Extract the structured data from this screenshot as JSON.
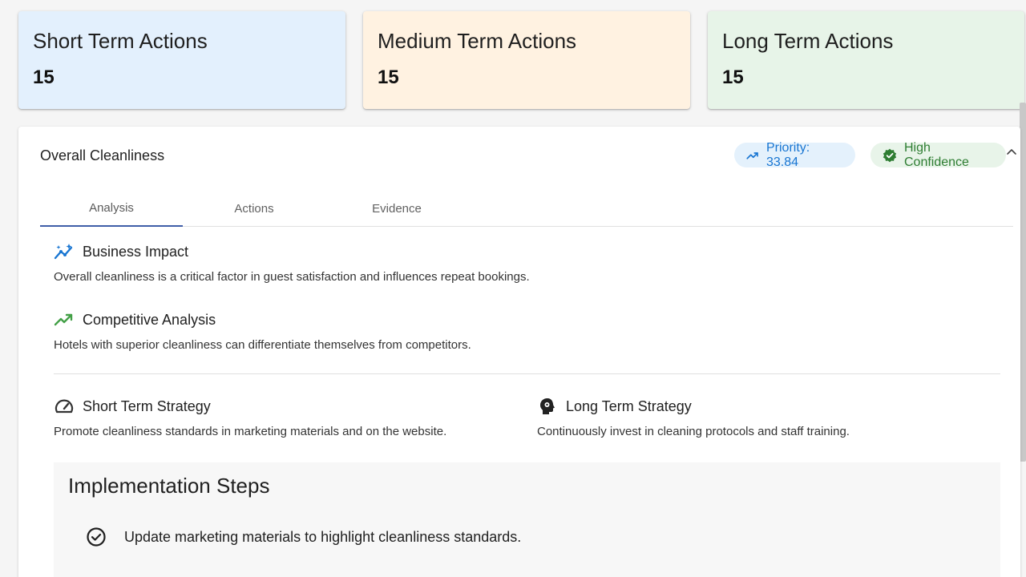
{
  "summary_cards": [
    {
      "title": "Short Term Actions",
      "value": "15",
      "color": "#e3f0fd"
    },
    {
      "title": "Medium Term Actions",
      "value": "15",
      "color": "#fff2e1"
    },
    {
      "title": "Long Term Actions",
      "value": "15",
      "color": "#e7f4e8"
    }
  ],
  "panel": {
    "title": "Overall Cleanliness",
    "priority_chip": {
      "label": "Priority: 33.84",
      "icon": "trending-up-icon",
      "color": "#1976d2"
    },
    "confidence_chip": {
      "label": "High Confidence",
      "icon": "verified-check-icon",
      "color": "#2e7d32"
    },
    "collapse_icon": "chevron-up-icon",
    "tabs": [
      {
        "label": "Analysis",
        "active": true
      },
      {
        "label": "Actions",
        "active": false
      },
      {
        "label": "Evidence",
        "active": false
      }
    ],
    "business_impact": {
      "heading": "Business Impact",
      "icon": "insights-icon",
      "text": "Overall cleanliness is a critical factor in guest satisfaction and influences repeat bookings."
    },
    "competitive_analysis": {
      "heading": "Competitive Analysis",
      "icon": "trending-up-icon",
      "text": "Hotels with superior cleanliness can differentiate themselves from competitors."
    },
    "short_term_strategy": {
      "heading": "Short Term Strategy",
      "icon": "speed-gauge-icon",
      "text": "Promote cleanliness standards in marketing materials and on the website."
    },
    "long_term_strategy": {
      "heading": "Long Term Strategy",
      "icon": "psychology-head-icon",
      "text": "Continuously invest in cleaning protocols and staff training."
    },
    "implementation": {
      "title": "Implementation Steps",
      "steps": [
        {
          "text": "Update marketing materials to highlight cleanliness standards.",
          "icon": "check-circle-icon"
        }
      ]
    }
  }
}
